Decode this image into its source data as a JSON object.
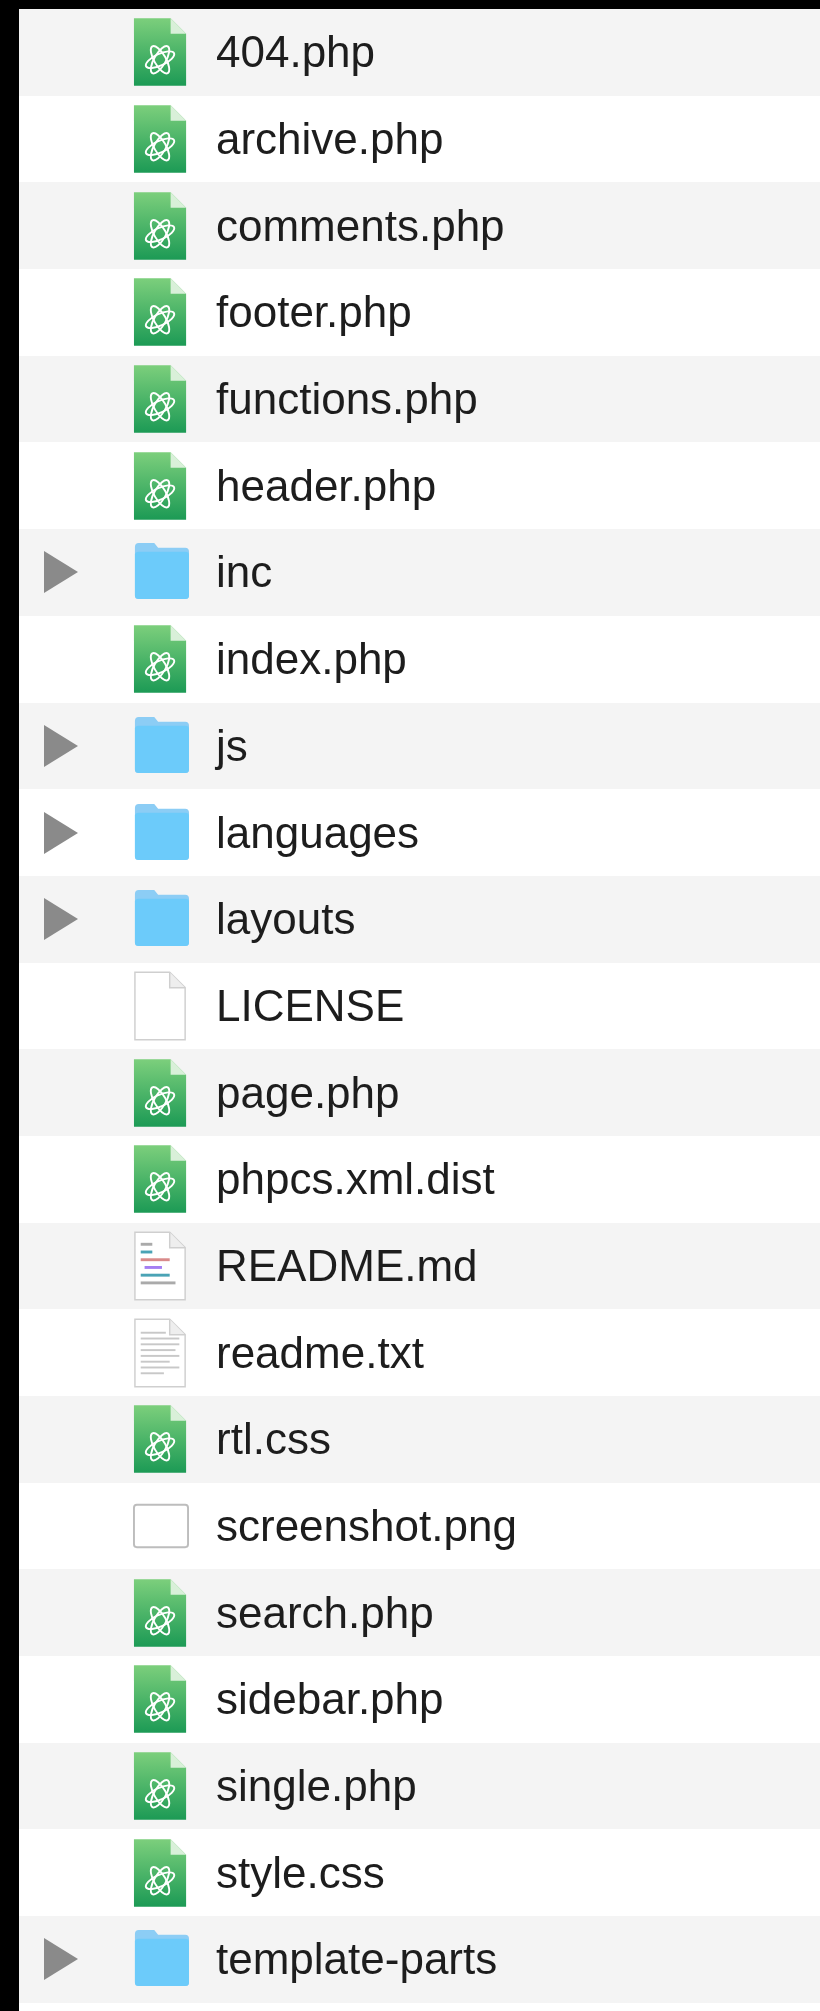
{
  "files": [
    {
      "name": "404.php",
      "kind": "code"
    },
    {
      "name": "archive.php",
      "kind": "code"
    },
    {
      "name": "comments.php",
      "kind": "code"
    },
    {
      "name": "footer.php",
      "kind": "code"
    },
    {
      "name": "functions.php",
      "kind": "code"
    },
    {
      "name": "header.php",
      "kind": "code"
    },
    {
      "name": "inc",
      "kind": "folder",
      "expanded": false
    },
    {
      "name": "index.php",
      "kind": "code"
    },
    {
      "name": "js",
      "kind": "folder",
      "expanded": false
    },
    {
      "name": "languages",
      "kind": "folder",
      "expanded": false
    },
    {
      "name": "layouts",
      "kind": "folder",
      "expanded": false
    },
    {
      "name": "LICENSE",
      "kind": "blank"
    },
    {
      "name": "page.php",
      "kind": "code"
    },
    {
      "name": "phpcs.xml.dist",
      "kind": "code"
    },
    {
      "name": "README.md",
      "kind": "markdown"
    },
    {
      "name": "readme.txt",
      "kind": "text"
    },
    {
      "name": "rtl.css",
      "kind": "code"
    },
    {
      "name": "screenshot.png",
      "kind": "image"
    },
    {
      "name": "search.php",
      "kind": "code"
    },
    {
      "name": "sidebar.php",
      "kind": "code"
    },
    {
      "name": "single.php",
      "kind": "code"
    },
    {
      "name": "style.css",
      "kind": "code"
    },
    {
      "name": "template-parts",
      "kind": "folder",
      "expanded": false
    }
  ]
}
